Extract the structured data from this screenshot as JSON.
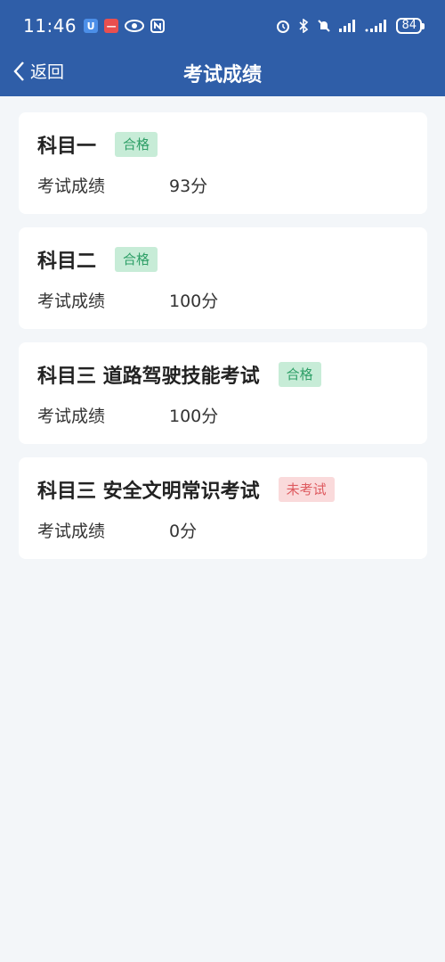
{
  "status_bar": {
    "time": "11:46",
    "battery": "84"
  },
  "nav": {
    "back_label": "返回",
    "title": "考试成绩"
  },
  "colors": {
    "header_bg": "#2f5ea8",
    "pass_bg": "#c7ecd7",
    "pass_text": "#2e9f67",
    "fail_bg": "#fadadb",
    "fail_text": "#de5a5f"
  },
  "results": [
    {
      "subject": "科目一",
      "status": "合格",
      "status_type": "pass",
      "score_label": "考试成绩",
      "score": "93分"
    },
    {
      "subject": "科目二",
      "status": "合格",
      "status_type": "pass",
      "score_label": "考试成绩",
      "score": "100分"
    },
    {
      "subject": "科目三 道路驾驶技能考试",
      "status": "合格",
      "status_type": "pass",
      "score_label": "考试成绩",
      "score": "100分"
    },
    {
      "subject": "科目三 安全文明常识考试",
      "status": "未考试",
      "status_type": "fail",
      "score_label": "考试成绩",
      "score": "0分"
    }
  ]
}
